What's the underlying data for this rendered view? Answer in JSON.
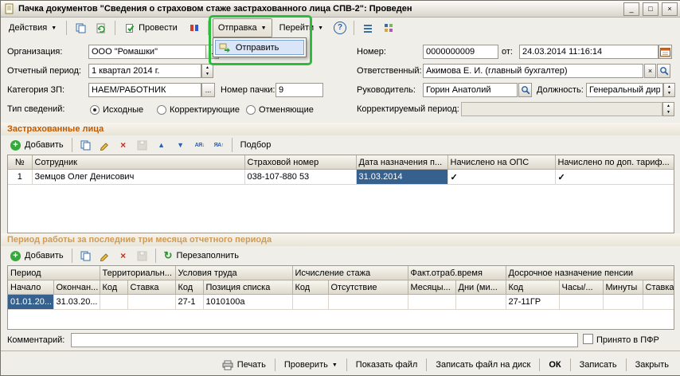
{
  "colors": {
    "selection": "#36618e",
    "section_header": "#c05a00",
    "section_header_dim": "#cf9a55",
    "annotation_highlight": "#2bbd3a"
  },
  "icons": {
    "minimize": "_",
    "maximize": "□",
    "close": "×",
    "dropdown_arrow": "▼",
    "ellipsis": "...",
    "spin_up": "▲",
    "spin_down": "▼",
    "combo_arrow": "▼",
    "clear": "×",
    "check": "✓",
    "add_plus": "+",
    "delete_cross": "×",
    "move_up": "▲",
    "move_down": "▼",
    "sort_asc": "АЯ↓",
    "sort_desc": "ЯА↑",
    "refresh": "↻",
    "help": "?"
  },
  "window": {
    "title": "Пачка документов \"Сведения о страховом стаже застрахованного лица СПВ-2\": Проведен"
  },
  "toolbar": {
    "actions_label": "Действия",
    "post_label": "Провести",
    "send_label": "Отправка",
    "goto_label": "Перейти",
    "send_menu": {
      "send_item": "Отправить"
    }
  },
  "form": {
    "org": {
      "label": "Организация:",
      "value": "ООО \"Ромашки\""
    },
    "number": {
      "label": "Номер:",
      "value": "0000000009"
    },
    "date": {
      "label": "от:",
      "value": "24.03.2014 11:16:14"
    },
    "period": {
      "label": "Отчетный период:",
      "value": "1 квартал 2014 г."
    },
    "responsible": {
      "label": "Ответственный:",
      "value": "Акимова Е. И. (главный бухгалтер)"
    },
    "category": {
      "label": "Категория ЗП:",
      "value": "НАЕМ/РАБОТНИК"
    },
    "pack_no": {
      "label": "Номер пачки:",
      "value": "9"
    },
    "manager": {
      "label": "Руководитель:",
      "value": "Горин Анатолий"
    },
    "position": {
      "label": "Должность:",
      "value": "Генеральный директ"
    },
    "info_type": {
      "label": "Тип сведений:",
      "options": [
        "Исходные",
        "Корректирующие",
        "Отменяющие"
      ],
      "selected": "Исходные"
    },
    "corr_period": {
      "label": "Корректируемый период:",
      "value": ""
    }
  },
  "insured": {
    "title": "Застрахованные лица",
    "add_label": "Добавить",
    "pick_label": "Подбор",
    "headers": [
      "№",
      "Сотрудник",
      "Страховой номер",
      "Дата назначения п...",
      "Начислено на ОПС",
      "Начислено по доп. тариф..."
    ],
    "row": {
      "num": "1",
      "employee": "Земцов Олег Денисович",
      "snils": "038-107-880 53",
      "date": "31.03.2014",
      "ops": "✓",
      "dop": "✓"
    }
  },
  "periods": {
    "title": "Период работы за последние три месяца отчетного периода",
    "add_label": "Добавить",
    "refill_label": "Перезаполнить",
    "groups": [
      "Период",
      "Территориальн...",
      "Условия труда",
      "Исчисление стажа",
      "Факт.отраб.время",
      "Досрочное назначение пенсии"
    ],
    "cols": [
      "Начало",
      "Окончан...",
      "Код",
      "Ставка",
      "Код",
      "Позиция списка",
      "Код",
      "Отсутствие",
      "Месяцы...",
      "Дни (ми...",
      "Код",
      "Часы/...",
      "Минуты",
      "Ставка"
    ],
    "row": [
      "01.01.20...",
      "31.03.20...",
      "",
      "",
      "27-1",
      "1010100а",
      "",
      "",
      "",
      "",
      "27-11ГР",
      "",
      "",
      ""
    ]
  },
  "footer": {
    "comment_label": "Комментарий:",
    "comment_value": "",
    "pfr_label": "Принято в ПФР",
    "print_label": "Печать",
    "check_label": "Проверить",
    "show_file_label": "Показать файл",
    "save_file_label": "Записать файл на диск",
    "ok_label": "ОК",
    "save_label": "Записать",
    "close_label": "Закрыть"
  }
}
